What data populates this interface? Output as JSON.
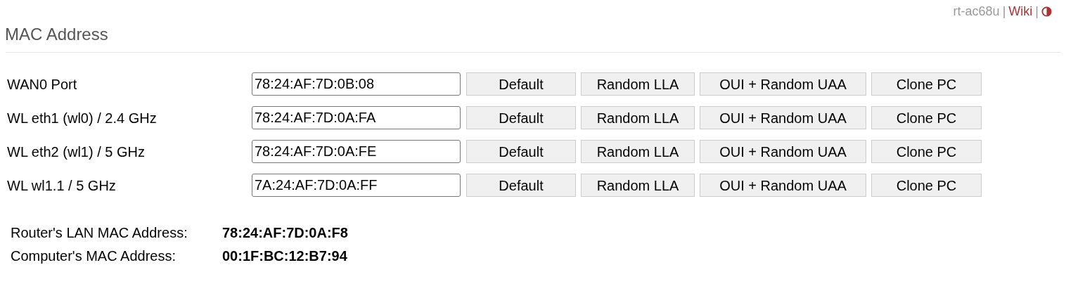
{
  "header": {
    "router": "rt-ac68u",
    "separator_1": "|",
    "wiki_link": "Wiki",
    "separator_2": "|"
  },
  "title": "MAC Address",
  "rows": [
    {
      "label": "WAN0 Port",
      "value": "78:24:AF:7D:0B:08",
      "buttons": [
        "Default",
        "Random LLA",
        "OUI + Random UAA",
        "Clone PC"
      ]
    },
    {
      "label": "WL eth1 (wl0) / 2.4 GHz",
      "value": "78:24:AF:7D:0A:FA",
      "buttons": [
        "Default",
        "Random LLA",
        "OUI + Random UAA",
        "Clone PC"
      ]
    },
    {
      "label": "WL eth2 (wl1) / 5 GHz",
      "value": "78:24:AF:7D:0A:FE",
      "buttons": [
        "Default",
        "Random LLA",
        "OUI + Random UAA",
        "Clone PC"
      ]
    },
    {
      "label": "WL wl1.1 / 5 GHz",
      "value": "7A:24:AF:7D:0A:FF",
      "buttons": [
        "Default",
        "Random LLA",
        "OUI + Random UAA",
        "Clone PC"
      ]
    }
  ],
  "info": [
    {
      "label": "Router's LAN MAC Address:",
      "value": "78:24:AF:7D:0A:F8"
    },
    {
      "label": "Computer's MAC Address:",
      "value": "00:1F:BC:12:B7:94"
    }
  ]
}
